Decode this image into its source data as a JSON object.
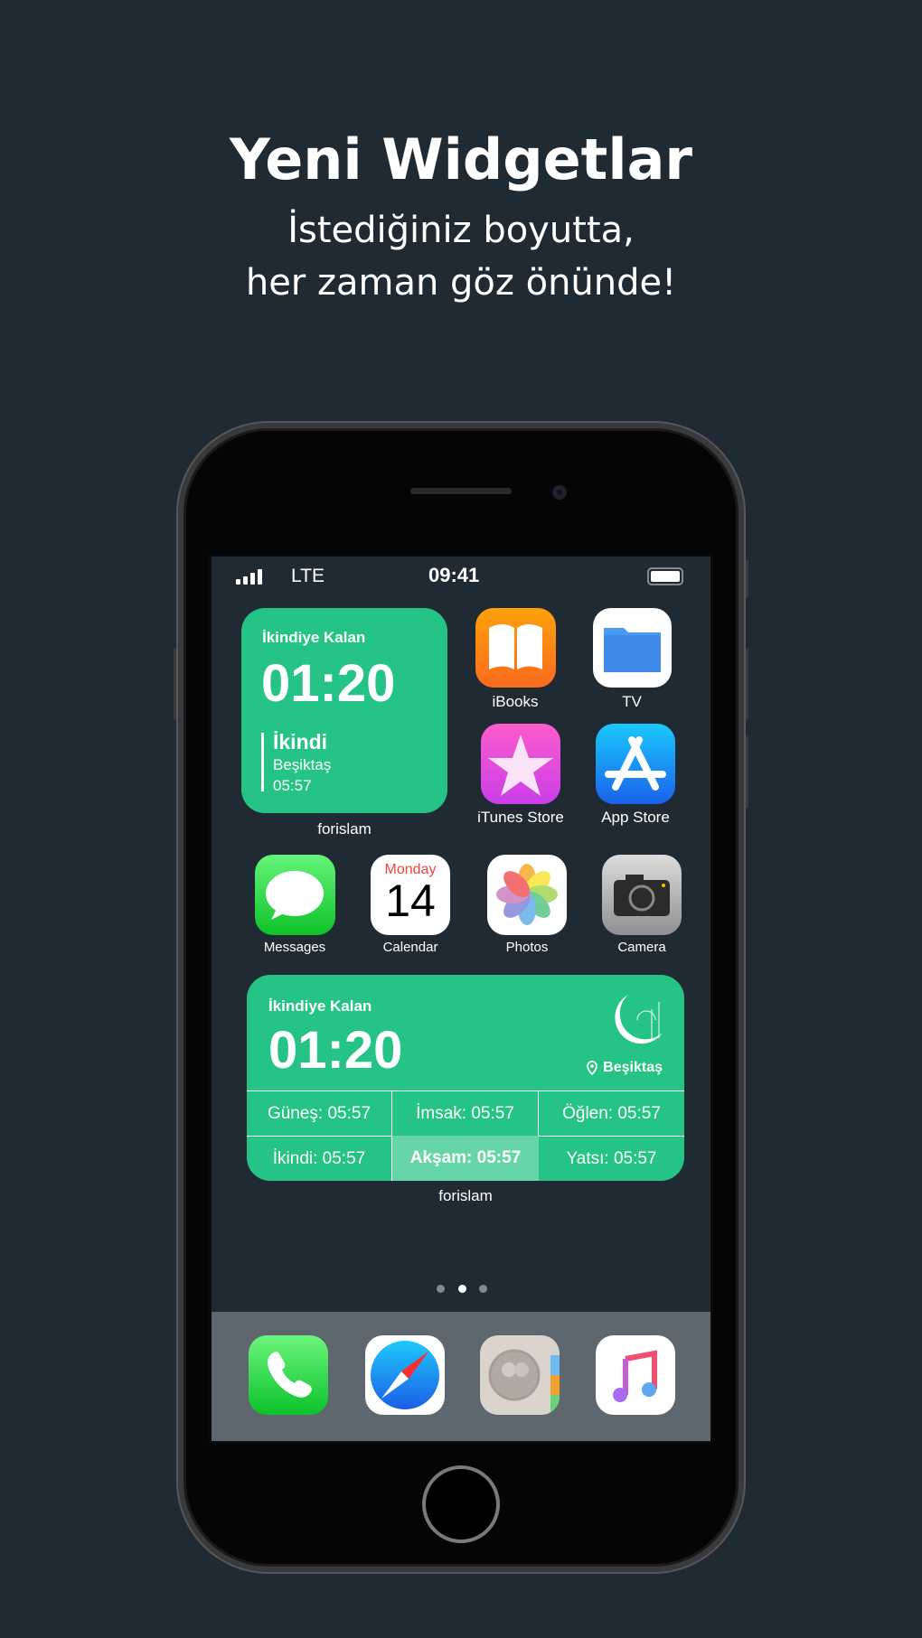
{
  "headline": {
    "title": "Yeni Widgetlar",
    "subtitle_line1": "İstediğiniz boyutta,",
    "subtitle_line2": "her zaman göz önünde!"
  },
  "status_bar": {
    "network": "LTE",
    "time": "09:41",
    "signal_icon": "signal-bars-icon",
    "battery_icon": "battery-icon"
  },
  "small_widget": {
    "heading": "İkindiye Kalan",
    "countdown": "01:20",
    "prayer": "İkindi",
    "location": "Beşiktaş",
    "time": "05:57",
    "app_label": "forislam"
  },
  "apps": [
    {
      "label": "iBooks",
      "icon": "book-icon"
    },
    {
      "label": "TV",
      "icon": "folder-icon"
    },
    {
      "label": "iTunes Store",
      "icon": "star-icon"
    },
    {
      "label": "App Store",
      "icon": "app-store-icon"
    },
    {
      "label": "Messages",
      "icon": "speech-bubble-icon"
    },
    {
      "label": "Calendar",
      "icon": "calendar-icon",
      "day_name": "Monday",
      "day_number": "14"
    },
    {
      "label": "Photos",
      "icon": "flower-icon"
    },
    {
      "label": "Camera",
      "icon": "camera-icon"
    }
  ],
  "large_widget": {
    "heading": "İkindiye Kalan",
    "countdown": "01:20",
    "location": "Beşiktaş",
    "app_label": "forislam",
    "times": [
      "Güneş: 05:57",
      "İmsak: 05:57",
      "Öğlen: 05:57",
      "İkindi: 05:57",
      "Akşam: 05:57",
      "Yatsı: 05:57"
    ],
    "highlighted": "Akşam: 05:57"
  },
  "page_dots": {
    "count": 3,
    "active": 2
  },
  "dock": [
    "phone-icon",
    "safari-compass-icon",
    "contacts-icon",
    "music-note-icon"
  ],
  "colors": {
    "background": "#1f2a33",
    "widget_green": "#25c486",
    "highlight_cell": "#66d6a9"
  }
}
